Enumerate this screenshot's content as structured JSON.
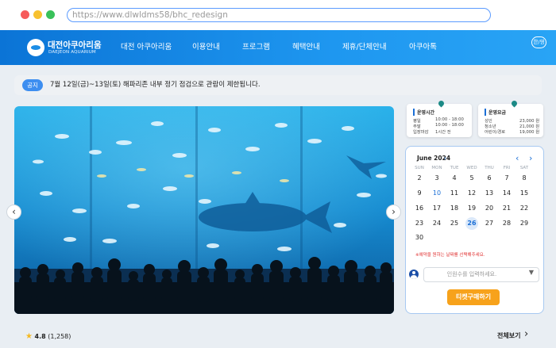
{
  "browser": {
    "url": "https://www.dlwldms58/bhc_redesign"
  },
  "header": {
    "logo_title": "대전아쿠아리움",
    "logo_sub": "DAEJEON AQUARIUM",
    "nav": [
      "대전 아쿠아리움",
      "이용안내",
      "프로그램",
      "혜택안내",
      "제휴/단체안내",
      "아쿠아톡"
    ],
    "lang": "한/영"
  },
  "notice": {
    "badge": "공지",
    "text": "7월 12일(금)~13일(토) 해파리존 내부 정기 점검으로 관람이 제한됩니다."
  },
  "hours_card": {
    "title": "운영시간",
    "rows": [
      {
        "label": "평일",
        "value": "10:00 - 18:00"
      },
      {
        "label": "주말",
        "value": "10:00 - 18:00"
      },
      {
        "label": "입장마감",
        "value": "1시간 전"
      }
    ]
  },
  "fee_card": {
    "title": "운영요금",
    "rows": [
      {
        "label": "성인",
        "value": "23,000 원"
      },
      {
        "label": "청소년",
        "value": "21,000 원"
      },
      {
        "label": "어린이/경로",
        "value": "19,000 원"
      }
    ]
  },
  "calendar": {
    "month": "June 2024",
    "month_arrow": "›",
    "prev": "‹",
    "next": "›",
    "weekdays": [
      "SUN",
      "MON",
      "TUE",
      "WED",
      "THU",
      "FRI",
      "SAT"
    ],
    "days": [
      [
        "2",
        "3",
        "4",
        "5",
        "6",
        "7",
        "8"
      ],
      [
        "9",
        "10",
        "11",
        "12",
        "13",
        "14",
        "15"
      ],
      [
        "16",
        "17",
        "18",
        "19",
        "20",
        "21",
        "22"
      ],
      [
        "23",
        "24",
        "25",
        "26",
        "27",
        "28",
        "29"
      ],
      [
        "30"
      ]
    ],
    "today": "10",
    "selected": "26",
    "note": "※예약을 원하는 날짜를 선택해주세요.",
    "count_placeholder": "인원수를 입력하세요.",
    "buy_button": "티켓구매하기"
  },
  "rating": {
    "score": "4.8",
    "count": "(1,258)",
    "view_all": "전체보기"
  },
  "colors": {
    "header": "#1b8de6",
    "accent": "#1b6fd6",
    "buy": "#f7a21b",
    "notice_badge": "#3d8ef0"
  },
  "icons": [
    "aquarium-logo-icon",
    "chevron-left-icon",
    "chevron-right-icon",
    "pin-icon",
    "person-icon",
    "caret-down-icon",
    "star-icon"
  ]
}
